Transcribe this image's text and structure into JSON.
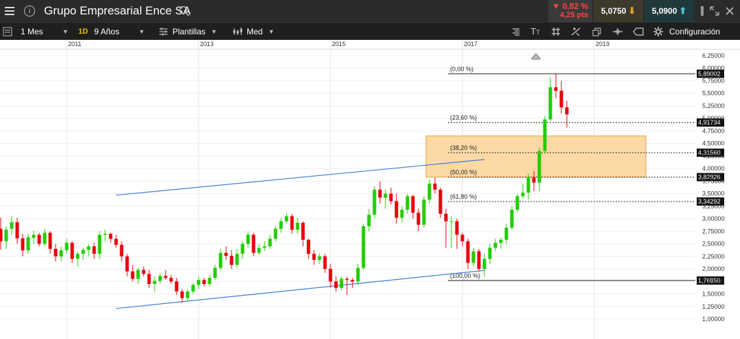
{
  "header": {
    "instrument": "Grupo Empresarial Ence SA",
    "change_pct": "▼ 0,82 %",
    "change_pts": "4,25 pts",
    "bid": "5,0750",
    "ask": "5,0900"
  },
  "toolbar": {
    "period": "1 Mes",
    "interval_badge": "1D",
    "range": "9 Años",
    "templates": "Plantillas",
    "line_style": "Med",
    "settings": "Configuración"
  },
  "colors": {
    "up_candle": "#22cc00",
    "down_candle": "#e8000b",
    "trend_line": "#3f7fd6",
    "fib_zone": "#fbd295",
    "topbar_bg": "#2b2b2b",
    "toolbar_bg": "#1f1f1f"
  },
  "chart_data": {
    "type": "candlestick",
    "x_axis": {
      "tick_labels": [
        "2011",
        "2013",
        "2015",
        "2017",
        "2019"
      ]
    },
    "y_axis": {
      "range": [
        1.0,
        6.25
      ],
      "tick_labels": [
        "6,25000",
        "6,00000",
        "5,75000",
        "5,50000",
        "5,25000",
        "5,00000",
        "4,75000",
        "4,50000",
        "4,25000",
        "4,00000",
        "3,75000",
        "3,50000",
        "3,25000",
        "3,00000",
        "2,75000",
        "2,50000",
        "2,25000",
        "2,00000",
        "1,75000",
        "1,50000",
        "1,25000",
        "1,00000"
      ],
      "tick_values": [
        6.25,
        6.0,
        5.75,
        5.5,
        5.25,
        5.0,
        4.75,
        4.5,
        4.25,
        4.0,
        3.75,
        3.5,
        3.25,
        3.0,
        2.75,
        2.5,
        2.25,
        2.0,
        1.75,
        1.5,
        1.25,
        1.0
      ]
    },
    "grid": true,
    "fibonacci": [
      {
        "label": "(0,00 %)",
        "price_label": "5,89002",
        "value": 5.89002
      },
      {
        "label": "(23,60 %)",
        "price_label": "4,91734",
        "value": 4.91734
      },
      {
        "label": "(38,20 %)",
        "price_label": "4,31560",
        "value": 4.3156
      },
      {
        "label": "(50,00 %)",
        "price_label": "3,82926",
        "value": 3.82926
      },
      {
        "label": "(61,80 %)",
        "price_label": "3,34292",
        "value": 3.34292
      },
      {
        "label": "(100,00 %)",
        "price_label": "1,76850",
        "value": 1.7685
      }
    ],
    "fib_zone": {
      "top": 4.65,
      "bottom": 3.83
    },
    "trendlines": [
      {
        "x": [
          "2011-10",
          "2017-05"
        ],
        "y": [
          3.47,
          4.18
        ]
      },
      {
        "x": [
          "2011-10",
          "2017-05"
        ],
        "y": [
          1.21,
          1.97
        ]
      }
    ],
    "candles": [
      {
        "date": "2010-01",
        "open": 2.8,
        "high": 3.02,
        "low": 2.38,
        "close": 2.55
      },
      {
        "date": "2010-02",
        "open": 2.55,
        "high": 2.85,
        "low": 2.4,
        "close": 2.78
      },
      {
        "date": "2010-03",
        "open": 2.8,
        "high": 3.05,
        "low": 2.68,
        "close": 2.93
      },
      {
        "date": "2010-04",
        "open": 2.93,
        "high": 3.02,
        "low": 2.5,
        "close": 2.61
      },
      {
        "date": "2010-05",
        "open": 2.61,
        "high": 2.7,
        "low": 2.25,
        "close": 2.37
      },
      {
        "date": "2010-06",
        "open": 2.37,
        "high": 2.7,
        "low": 2.3,
        "close": 2.63
      },
      {
        "date": "2010-07",
        "open": 2.62,
        "high": 2.76,
        "low": 2.5,
        "close": 2.68
      },
      {
        "date": "2010-08",
        "open": 2.68,
        "high": 2.72,
        "low": 2.45,
        "close": 2.5
      },
      {
        "date": "2010-09",
        "open": 2.5,
        "high": 2.8,
        "low": 2.45,
        "close": 2.72
      },
      {
        "date": "2010-10",
        "open": 2.72,
        "high": 2.75,
        "low": 2.3,
        "close": 2.4
      },
      {
        "date": "2010-11",
        "open": 2.4,
        "high": 2.5,
        "low": 2.15,
        "close": 2.25
      },
      {
        "date": "2010-12",
        "open": 2.25,
        "high": 2.45,
        "low": 2.15,
        "close": 2.37
      },
      {
        "date": "2011-01",
        "open": 2.37,
        "high": 2.6,
        "low": 2.3,
        "close": 2.52
      },
      {
        "date": "2011-02",
        "open": 2.52,
        "high": 2.55,
        "low": 2.12,
        "close": 2.2
      },
      {
        "date": "2011-03",
        "open": 2.2,
        "high": 2.35,
        "low": 2.05,
        "close": 2.3
      },
      {
        "date": "2011-04",
        "open": 2.3,
        "high": 2.42,
        "low": 2.18,
        "close": 2.38
      },
      {
        "date": "2011-05",
        "open": 2.38,
        "high": 2.5,
        "low": 2.25,
        "close": 2.45
      },
      {
        "date": "2011-06",
        "open": 2.45,
        "high": 2.52,
        "low": 2.2,
        "close": 2.3
      },
      {
        "date": "2011-07",
        "open": 2.3,
        "high": 2.75,
        "low": 2.2,
        "close": 2.68
      },
      {
        "date": "2011-08",
        "open": 2.68,
        "high": 2.78,
        "low": 2.55,
        "close": 2.7
      },
      {
        "date": "2011-09",
        "open": 2.7,
        "high": 2.72,
        "low": 2.52,
        "close": 2.6
      },
      {
        "date": "2011-10",
        "open": 2.6,
        "high": 2.68,
        "low": 2.42,
        "close": 2.48
      },
      {
        "date": "2011-11",
        "open": 2.48,
        "high": 2.55,
        "low": 2.15,
        "close": 2.25
      },
      {
        "date": "2011-12",
        "open": 2.25,
        "high": 2.3,
        "low": 1.85,
        "close": 1.95
      },
      {
        "date": "2012-01",
        "open": 1.95,
        "high": 2.08,
        "low": 1.75,
        "close": 1.8
      },
      {
        "date": "2012-02",
        "open": 1.8,
        "high": 2.02,
        "low": 1.7,
        "close": 1.98
      },
      {
        "date": "2012-03",
        "open": 1.98,
        "high": 2.05,
        "low": 1.85,
        "close": 1.9
      },
      {
        "date": "2012-04",
        "open": 1.9,
        "high": 1.98,
        "low": 1.62,
        "close": 1.7
      },
      {
        "date": "2012-05",
        "open": 1.7,
        "high": 1.85,
        "low": 1.55,
        "close": 1.76
      },
      {
        "date": "2012-06",
        "open": 1.76,
        "high": 1.92,
        "low": 1.7,
        "close": 1.86
      },
      {
        "date": "2012-07",
        "open": 1.86,
        "high": 1.98,
        "low": 1.78,
        "close": 1.82
      },
      {
        "date": "2012-08",
        "open": 1.82,
        "high": 1.88,
        "low": 1.7,
        "close": 1.75
      },
      {
        "date": "2012-09",
        "open": 1.75,
        "high": 1.82,
        "low": 1.48,
        "close": 1.55
      },
      {
        "date": "2012-10",
        "open": 1.55,
        "high": 1.6,
        "low": 1.32,
        "close": 1.42
      },
      {
        "date": "2012-11",
        "open": 1.42,
        "high": 1.6,
        "low": 1.35,
        "close": 1.55
      },
      {
        "date": "2012-12",
        "open": 1.55,
        "high": 1.72,
        "low": 1.5,
        "close": 1.68
      },
      {
        "date": "2013-01",
        "open": 1.68,
        "high": 1.85,
        "low": 1.6,
        "close": 1.78
      },
      {
        "date": "2013-02",
        "open": 1.78,
        "high": 1.82,
        "low": 1.65,
        "close": 1.7
      },
      {
        "date": "2013-03",
        "open": 1.7,
        "high": 1.88,
        "low": 1.65,
        "close": 1.82
      },
      {
        "date": "2013-04",
        "open": 1.82,
        "high": 2.08,
        "low": 1.78,
        "close": 2.02
      },
      {
        "date": "2013-05",
        "open": 2.02,
        "high": 2.4,
        "low": 1.98,
        "close": 2.32
      },
      {
        "date": "2013-06",
        "open": 2.32,
        "high": 2.45,
        "low": 2.18,
        "close": 2.26
      },
      {
        "date": "2013-07",
        "open": 2.26,
        "high": 2.38,
        "low": 2.0,
        "close": 2.08
      },
      {
        "date": "2013-08",
        "open": 2.08,
        "high": 2.4,
        "low": 2.02,
        "close": 2.3
      },
      {
        "date": "2013-09",
        "open": 2.3,
        "high": 2.55,
        "low": 2.2,
        "close": 2.5
      },
      {
        "date": "2013-10",
        "open": 2.5,
        "high": 2.75,
        "low": 2.42,
        "close": 2.68
      },
      {
        "date": "2013-11",
        "open": 2.68,
        "high": 2.72,
        "low": 2.25,
        "close": 2.32
      },
      {
        "date": "2013-12",
        "open": 2.32,
        "high": 2.5,
        "low": 2.28,
        "close": 2.42
      },
      {
        "date": "2014-01",
        "open": 2.42,
        "high": 2.55,
        "low": 2.35,
        "close": 2.45
      },
      {
        "date": "2014-02",
        "open": 2.45,
        "high": 2.68,
        "low": 2.4,
        "close": 2.6
      },
      {
        "date": "2014-03",
        "open": 2.6,
        "high": 2.85,
        "low": 2.55,
        "close": 2.8
      },
      {
        "date": "2014-04",
        "open": 2.8,
        "high": 3.02,
        "low": 2.72,
        "close": 2.95
      },
      {
        "date": "2014-05",
        "open": 2.95,
        "high": 3.12,
        "low": 2.9,
        "close": 3.05
      },
      {
        "date": "2014-06",
        "open": 3.05,
        "high": 3.1,
        "low": 2.7,
        "close": 2.78
      },
      {
        "date": "2014-07",
        "open": 2.78,
        "high": 3.02,
        "low": 2.7,
        "close": 2.92
      },
      {
        "date": "2014-08",
        "open": 2.92,
        "high": 2.95,
        "low": 2.45,
        "close": 2.58
      },
      {
        "date": "2014-09",
        "open": 2.58,
        "high": 2.6,
        "low": 2.2,
        "close": 2.3
      },
      {
        "date": "2014-10",
        "open": 2.3,
        "high": 2.38,
        "low": 2.08,
        "close": 2.18
      },
      {
        "date": "2014-11",
        "open": 2.18,
        "high": 2.32,
        "low": 2.1,
        "close": 2.25
      },
      {
        "date": "2014-12",
        "open": 2.25,
        "high": 2.3,
        "low": 1.92,
        "close": 2.0
      },
      {
        "date": "2015-01",
        "open": 2.0,
        "high": 2.1,
        "low": 1.62,
        "close": 1.75
      },
      {
        "date": "2015-02",
        "open": 1.75,
        "high": 1.85,
        "low": 1.55,
        "close": 1.62
      },
      {
        "date": "2015-03",
        "open": 1.62,
        "high": 1.85,
        "low": 1.58,
        "close": 1.8
      },
      {
        "date": "2015-04",
        "open": 1.8,
        "high": 1.85,
        "low": 1.48,
        "close": 1.78
      },
      {
        "date": "2015-05",
        "open": 1.78,
        "high": 1.82,
        "low": 1.62,
        "close": 1.75
      },
      {
        "date": "2015-06",
        "open": 1.75,
        "high": 2.1,
        "low": 1.68,
        "close": 2.02
      },
      {
        "date": "2015-07",
        "open": 2.02,
        "high": 2.9,
        "low": 1.98,
        "close": 2.85
      },
      {
        "date": "2015-08",
        "open": 2.85,
        "high": 3.2,
        "low": 2.75,
        "close": 3.08
      },
      {
        "date": "2015-09",
        "open": 3.08,
        "high": 3.65,
        "low": 3.02,
        "close": 3.58
      },
      {
        "date": "2015-10",
        "open": 3.58,
        "high": 3.75,
        "low": 3.3,
        "close": 3.42
      },
      {
        "date": "2015-11",
        "open": 3.42,
        "high": 3.58,
        "low": 3.2,
        "close": 3.5
      },
      {
        "date": "2015-12",
        "open": 3.5,
        "high": 3.62,
        "low": 3.28,
        "close": 3.35
      },
      {
        "date": "2016-01",
        "open": 3.35,
        "high": 3.5,
        "low": 2.9,
        "close": 3.02
      },
      {
        "date": "2016-02",
        "open": 3.02,
        "high": 3.25,
        "low": 2.92,
        "close": 3.18
      },
      {
        "date": "2016-03",
        "open": 3.18,
        "high": 3.5,
        "low": 3.1,
        "close": 3.45
      },
      {
        "date": "2016-04",
        "open": 3.45,
        "high": 3.48,
        "low": 3.0,
        "close": 3.12
      },
      {
        "date": "2016-05",
        "open": 3.12,
        "high": 3.2,
        "low": 2.75,
        "close": 2.88
      },
      {
        "date": "2016-06",
        "open": 2.88,
        "high": 3.45,
        "low": 2.82,
        "close": 3.38
      },
      {
        "date": "2016-07",
        "open": 3.38,
        "high": 3.78,
        "low": 3.3,
        "close": 3.7
      },
      {
        "date": "2016-08",
        "open": 3.7,
        "high": 3.82,
        "low": 3.5,
        "close": 3.58
      },
      {
        "date": "2016-09",
        "open": 3.58,
        "high": 3.62,
        "low": 3.02,
        "close": 3.1
      },
      {
        "date": "2016-10",
        "open": 3.1,
        "high": 3.2,
        "low": 2.42,
        "close": 2.95
      },
      {
        "date": "2016-11",
        "open": 2.95,
        "high": 3.05,
        "low": 2.42,
        "close": 2.95
      },
      {
        "date": "2016-12",
        "open": 2.95,
        "high": 3.0,
        "low": 2.4,
        "close": 2.68
      },
      {
        "date": "2017-01",
        "open": 2.68,
        "high": 2.72,
        "low": 2.45,
        "close": 2.55
      },
      {
        "date": "2017-02",
        "open": 2.55,
        "high": 2.6,
        "low": 2.0,
        "close": 2.12
      },
      {
        "date": "2017-03",
        "open": 2.12,
        "high": 2.42,
        "low": 2.05,
        "close": 2.35
      },
      {
        "date": "2017-04",
        "open": 2.35,
        "high": 2.4,
        "low": 1.95,
        "close": 2.0
      },
      {
        "date": "2017-05",
        "open": 2.0,
        "high": 2.3,
        "low": 1.85,
        "close": 2.2
      },
      {
        "date": "2017-06",
        "open": 2.2,
        "high": 2.5,
        "low": 2.1,
        "close": 2.42
      },
      {
        "date": "2017-07",
        "open": 2.42,
        "high": 2.6,
        "low": 2.35,
        "close": 2.52
      },
      {
        "date": "2017-08",
        "open": 2.52,
        "high": 2.62,
        "low": 2.4,
        "close": 2.58
      },
      {
        "date": "2017-09",
        "open": 2.58,
        "high": 2.9,
        "low": 2.5,
        "close": 2.82
      },
      {
        "date": "2017-10",
        "open": 2.82,
        "high": 3.25,
        "low": 2.78,
        "close": 3.18
      },
      {
        "date": "2017-11",
        "open": 3.18,
        "high": 3.5,
        "low": 3.12,
        "close": 3.45
      },
      {
        "date": "2017-12",
        "open": 3.45,
        "high": 3.7,
        "low": 3.4,
        "close": 3.52
      },
      {
        "date": "2018-01",
        "open": 3.52,
        "high": 3.9,
        "low": 3.38,
        "close": 3.82
      },
      {
        "date": "2018-02",
        "open": 3.82,
        "high": 3.95,
        "low": 3.55,
        "close": 3.72
      },
      {
        "date": "2018-03",
        "open": 3.72,
        "high": 4.42,
        "low": 3.55,
        "close": 4.35
      },
      {
        "date": "2018-04",
        "open": 4.35,
        "high": 5.05,
        "low": 4.3,
        "close": 4.98
      },
      {
        "date": "2018-05",
        "open": 4.98,
        "high": 5.82,
        "low": 4.95,
        "close": 5.62
      },
      {
        "date": "2018-06",
        "open": 5.62,
        "high": 5.89,
        "low": 5.4,
        "close": 5.55
      },
      {
        "date": "2018-07",
        "open": 5.55,
        "high": 5.75,
        "low": 5.1,
        "close": 5.22
      },
      {
        "date": "2018-08",
        "open": 5.22,
        "high": 5.35,
        "low": 4.82,
        "close": 5.08
      }
    ]
  }
}
